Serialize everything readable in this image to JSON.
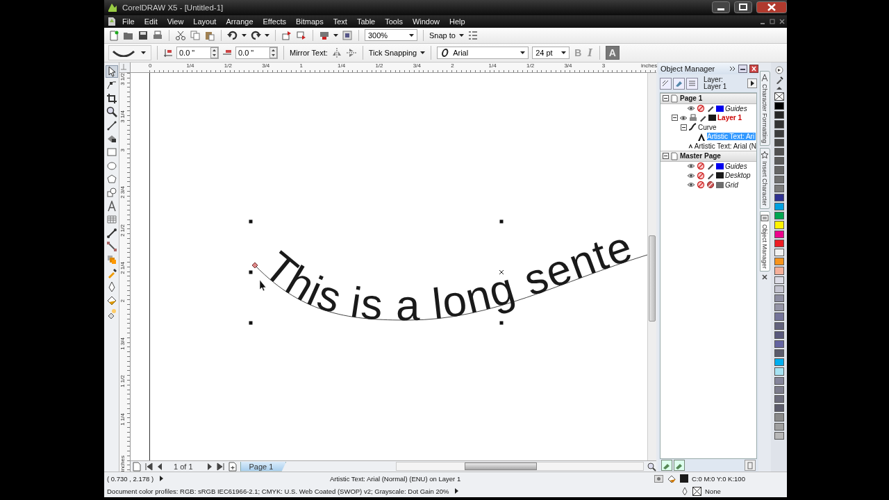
{
  "window": {
    "title": "CorelDRAW X5 - [Untitled-1]"
  },
  "menu": [
    "File",
    "Edit",
    "View",
    "Layout",
    "Arrange",
    "Effects",
    "Bitmaps",
    "Text",
    "Table",
    "Tools",
    "Window",
    "Help"
  ],
  "standard_toolbar": {
    "zoom": "300%",
    "snap": "Snap to"
  },
  "property_bar": {
    "offset_1": "0.0 \"",
    "offset_2": "0.0 \"",
    "mirror_label": "Mirror Text:",
    "tick_snapping": "Tick Snapping",
    "font": "Arial",
    "font_size": "24 pt",
    "bold_key": "B",
    "italic_key": "I",
    "place_key": "A",
    "place_on": true
  },
  "rulers": {
    "horizontal": [
      "0",
      "1/4",
      "1/2",
      "3/4",
      "1",
      "1/4",
      "1/2",
      "3/4",
      "2",
      "1/4",
      "1/2",
      "3/4",
      "3"
    ],
    "horizontal_unit": "inches",
    "vertical": [
      "3 1/2",
      "3 1/4",
      "3",
      "2 3/4",
      "2 1/2",
      "2 1/4",
      "2",
      "1 3/4",
      "1 1/2",
      "1 1/4"
    ],
    "vertical_unit": "inches"
  },
  "canvas": {
    "curved_text": "This is a long sente"
  },
  "page_nav": {
    "position": "1 of 1",
    "tabs": [
      {
        "label": "Page 1",
        "selected": true
      }
    ]
  },
  "object_manager": {
    "title": "Object Manager",
    "layer_label": "Layer:",
    "layer_name": "Layer 1",
    "tree": [
      {
        "label": "Page 1",
        "kind": "page",
        "expanded": true,
        "selected": false,
        "children": [
          {
            "label": "Guides",
            "kind": "layer",
            "color": "#0000ee",
            "printable": false,
            "editable": true,
            "active": false,
            "selected": false
          },
          {
            "label": "Layer 1",
            "kind": "layer",
            "color": "#1a1a1a",
            "printable": true,
            "editable": true,
            "active": true,
            "expanded": true,
            "selected": false,
            "children": [
              {
                "label": "Curve",
                "kind": "curve",
                "expanded": true,
                "selected": false,
                "children": [
                  {
                    "label": "Artistic Text: Ari",
                    "kind": "text",
                    "selected": true
                  }
                ]
              },
              {
                "label": "Artistic Text: Arial (N",
                "kind": "text",
                "selected": false
              }
            ]
          }
        ]
      },
      {
        "label": "Master Page",
        "kind": "page",
        "expanded": true,
        "selected": false,
        "children": [
          {
            "label": "Guides",
            "kind": "layer",
            "color": "#0000ee",
            "printable": false,
            "editable": true,
            "active": false,
            "selected": false
          },
          {
            "label": "Desktop",
            "kind": "layer",
            "color": "#1a1a1a",
            "printable": false,
            "editable": true,
            "active": false,
            "selected": false
          },
          {
            "label": "Grid",
            "kind": "layer",
            "color": "#6e6e6e",
            "printable": false,
            "editable": false,
            "active": false,
            "selected": false
          }
        ]
      }
    ]
  },
  "docker_tabs": [
    {
      "label": "Character Formatting",
      "selected": false
    },
    {
      "label": "Insert Character",
      "selected": false
    },
    {
      "label": "Object Manager",
      "selected": true
    }
  ],
  "palette": [
    {
      "color": "#000000"
    },
    {
      "color": "#262626"
    },
    {
      "color": "#333333"
    },
    {
      "color": "#3d3d3d"
    },
    {
      "color": "#474747"
    },
    {
      "color": "#525252"
    },
    {
      "color": "#5c5c5c"
    },
    {
      "color": "#666666"
    },
    {
      "color": "#707070"
    },
    {
      "color": "#7a7a7a"
    },
    {
      "color": "#2e3192"
    },
    {
      "color": "#00a0e0"
    },
    {
      "color": "#00a651"
    },
    {
      "color": "#fff200"
    },
    {
      "color": "#ec008c"
    },
    {
      "color": "#ed1c24"
    },
    {
      "color": "#f2f2f2"
    },
    {
      "color": "#f7941d"
    },
    {
      "color": "#f5b09a"
    },
    {
      "color": "#dcdce6"
    },
    {
      "color": "#c4c4d0"
    },
    {
      "color": "#8c8ca0"
    },
    {
      "color": "#9494a6"
    },
    {
      "color": "#74749a"
    },
    {
      "color": "#62627c"
    },
    {
      "color": "#58587c"
    },
    {
      "color": "#6464a0"
    },
    {
      "color": "#5c5c6c"
    },
    {
      "color": "#00aeef"
    },
    {
      "color": "#a6e2f2"
    },
    {
      "color": "#84849a"
    },
    {
      "color": "#7c7c8c"
    },
    {
      "color": "#6c6c7c"
    },
    {
      "color": "#5c5c6c"
    },
    {
      "color": "#8a8a8a"
    },
    {
      "color": "#a0a0a0"
    },
    {
      "color": "#b8b8b8"
    }
  ],
  "status": {
    "coords": "( 0.730 , 2.178 )",
    "info": "Artistic Text: Arial (Normal) (ENU) on Layer 1",
    "fill_swatch": {
      "color": "#1a1a1a"
    },
    "fill": "C:0 M:0 Y:0 K:100",
    "outline": "None",
    "profiles": "Document color profiles: RGB: sRGB IEC61966-2.1; CMYK: U.S. Web Coated (SWOP) v2; Grayscale: Dot Gain 20%"
  }
}
